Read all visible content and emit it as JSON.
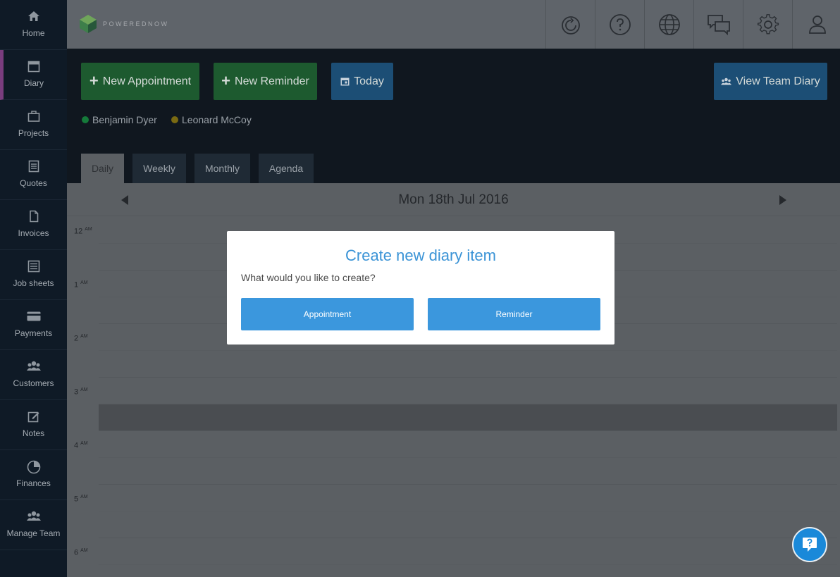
{
  "sidebar": {
    "items": [
      {
        "label": "Home",
        "icon": "home-icon"
      },
      {
        "label": "Diary",
        "icon": "calendar-icon"
      },
      {
        "label": "Projects",
        "icon": "briefcase-icon"
      },
      {
        "label": "Quotes",
        "icon": "quote-icon"
      },
      {
        "label": "Invoices",
        "icon": "invoice-icon"
      },
      {
        "label": "Job sheets",
        "icon": "list-icon"
      },
      {
        "label": "Payments",
        "icon": "card-icon"
      },
      {
        "label": "Customers",
        "icon": "users-icon"
      },
      {
        "label": "Notes",
        "icon": "edit-icon"
      },
      {
        "label": "Finances",
        "icon": "pie-chart-icon"
      },
      {
        "label": "Manage Team",
        "icon": "team-icon"
      }
    ]
  },
  "topbar": {
    "logo_text": "POWEREDNOW",
    "icons": [
      "refresh-icon",
      "help-icon",
      "globe-icon",
      "chat-icon",
      "settings-icon",
      "user-icon"
    ]
  },
  "toolbar": {
    "new_appointment": "New Appointment",
    "new_reminder": "New Reminder",
    "today": "Today",
    "view_team_diary": "View Team Diary"
  },
  "staff": [
    {
      "name": "Benjamin Dyer",
      "color": "#157a3a"
    },
    {
      "name": "Leonard McCoy",
      "color": "#7a6a12"
    }
  ],
  "tabs": [
    "Daily",
    "Weekly",
    "Monthly",
    "Agenda"
  ],
  "calendar": {
    "date": "Mon 18th Jul 2016",
    "hours": [
      "12",
      "1",
      "2",
      "3",
      "4",
      "5",
      "6"
    ],
    "meridiem": "AM"
  },
  "modal": {
    "title": "Create new diary item",
    "question": "What would you like to create?",
    "appointment": "Appointment",
    "reminder": "Reminder"
  },
  "colors": {
    "accent_blue": "#3b97dd",
    "active_marker": "#7a3d7e"
  }
}
